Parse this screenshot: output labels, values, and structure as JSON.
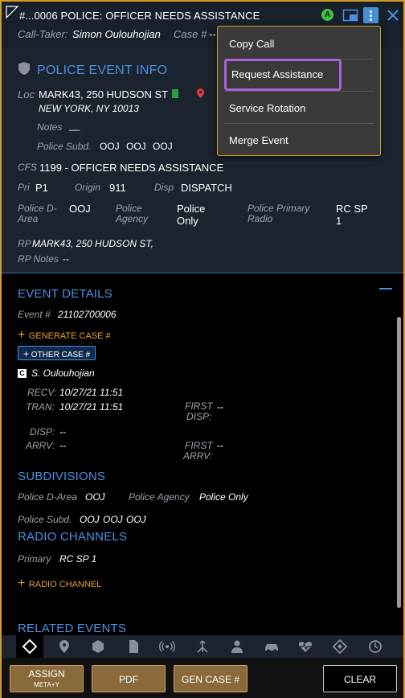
{
  "window": {
    "title": "#...0006 POLICE: OFFICER NEEDS ASSISTANCE",
    "avail_badge": "A",
    "accent": "#d89a1e"
  },
  "subhead": {
    "call_taker_label": "Call-Taker:",
    "call_taker_value": "Simon Oulouhojian",
    "case_label": "Case #",
    "case_value": "--"
  },
  "menu": {
    "items": [
      "Copy Call",
      "Request Assistance",
      "Service Rotation",
      "Merge Event"
    ],
    "highlighted": "Request Assistance"
  },
  "police_event_info": {
    "title": "POLICE EVENT INFO",
    "loc_label": "Loc",
    "loc_line1": "MARK43, 250 HUDSON ST",
    "loc_line2": "NEW YORK, NY 10013",
    "notes_label": "Notes",
    "notes_value": "__",
    "subd_label": "Police Subd.",
    "subd_values": [
      "OOJ",
      "OOJ",
      "OOJ"
    ],
    "cfs_label": "CFS",
    "cfs_value": "1199 - OFFICER NEEDS ASSISTANCE",
    "pri_label": "Pri",
    "pri_value": "P1",
    "origin_label": "Origin",
    "origin_value": "911",
    "disp_label": "Disp",
    "disp_value": "DISPATCH",
    "darea_label_1": "Police D-",
    "darea_label_2": "Area",
    "darea_value": "OOJ",
    "agency_label_1": "Police",
    "agency_label_2": "Agency",
    "agency_value_1": "Police",
    "agency_value_2": "Only",
    "radio_label_1": "Police Primary",
    "radio_label_2": "Radio",
    "radio_value_1": "RC SP",
    "radio_value_2": "1",
    "rp_label": "RP",
    "rp_value": "MARK43, 250 HUDSON ST,",
    "rp_notes_label": "RP Notes",
    "rp_notes_value": "--"
  },
  "event_details": {
    "title": "EVENT DETAILS",
    "event_label": "Event #",
    "event_value": "21102700006",
    "generate_case": "GENERATE CASE #",
    "other_case": "OTHER CASE #",
    "creator_badge": "C",
    "creator_name": "S. Oulouhojian",
    "recv_label": "RECV:",
    "recv_value": "10/27/21 11:51",
    "tran_label": "TRAN:",
    "tran_value": "10/27/21 11:51",
    "first_disp_label_1": "FIRST",
    "first_disp_label_2": "DISP:",
    "first_disp_value": "--",
    "disp_label": "DISP:",
    "disp_value": "--",
    "arrv_label": "ARRV:",
    "arrv_value": "--",
    "first_arrv_label_1": "FIRST",
    "first_arrv_label_2": "ARRV:",
    "first_arrv_value": "--"
  },
  "subdivisions": {
    "title": "SUBDIVISIONS",
    "darea_label": "Police D-Area",
    "darea_value": "OOJ",
    "agency_label": "Police Agency",
    "agency_value": "Police Only",
    "subd_label": "Police Subd.",
    "subd_values": [
      "OOJ",
      "OOJ",
      "OOJ"
    ]
  },
  "radio_channels": {
    "title": "RADIO CHANNELS",
    "primary_label": "Primary",
    "primary_value": "RC SP 1",
    "add_label": "RADIO CHANNEL"
  },
  "related_events": {
    "title": "RELATED EVENTS"
  },
  "iconbar": {
    "icons": [
      "details-icon",
      "location-icon",
      "hexagon-icon",
      "document-icon",
      "radio-waves-icon",
      "merge-icon",
      "person-icon",
      "vehicle-icon",
      "medical-icon",
      "diamond-icon",
      "history-icon"
    ]
  },
  "buttons": {
    "assign": "ASSIGN",
    "assign_shortcut": "META+Y",
    "pdf": "PDF",
    "gen_case": "GEN CASE #",
    "clear": "CLEAR"
  }
}
